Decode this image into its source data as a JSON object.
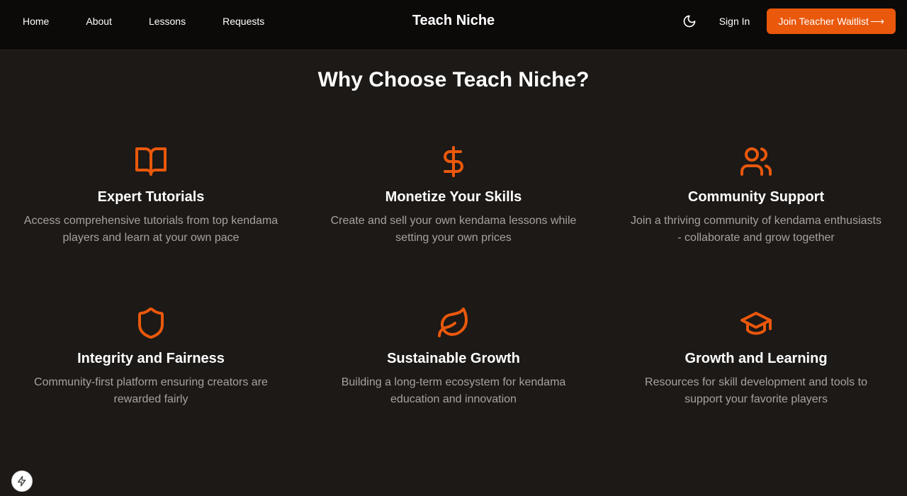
{
  "nav": {
    "links": [
      "Home",
      "About",
      "Lessons",
      "Requests"
    ],
    "brand": "Teach Niche",
    "theme_icon": "moon-icon",
    "sign_in": "Sign In",
    "cta_label": "Join Teacher Waitlist",
    "cta_arrow": "⟶"
  },
  "section": {
    "title": "Why Choose Teach Niche?"
  },
  "features": [
    {
      "icon": "book-open-icon",
      "title": "Expert Tutorials",
      "desc": "Access comprehensive tutorials from top kendama players and learn at your own pace"
    },
    {
      "icon": "dollar-sign-icon",
      "title": "Monetize Your Skills",
      "desc": "Create and sell your own kendama lessons while setting your own prices"
    },
    {
      "icon": "users-icon",
      "title": "Community Support",
      "desc": "Join a thriving community of kendama enthusiasts - collaborate and grow together"
    },
    {
      "icon": "shield-icon",
      "title": "Integrity and Fairness",
      "desc": "Community-first platform ensuring creators are rewarded fairly"
    },
    {
      "icon": "leaf-icon",
      "title": "Sustainable Growth",
      "desc": "Building a long-term ecosystem for kendama education and innovation"
    },
    {
      "icon": "graduation-cap-icon",
      "title": "Growth and Learning",
      "desc": "Resources for skill development and tools to support your favorite players"
    }
  ],
  "colors": {
    "accent": "#ea580c",
    "background": "#1c1917",
    "nav_background": "#0c0a09",
    "muted_text": "#a8a29e"
  },
  "floating_button_icon": "lightning-icon"
}
